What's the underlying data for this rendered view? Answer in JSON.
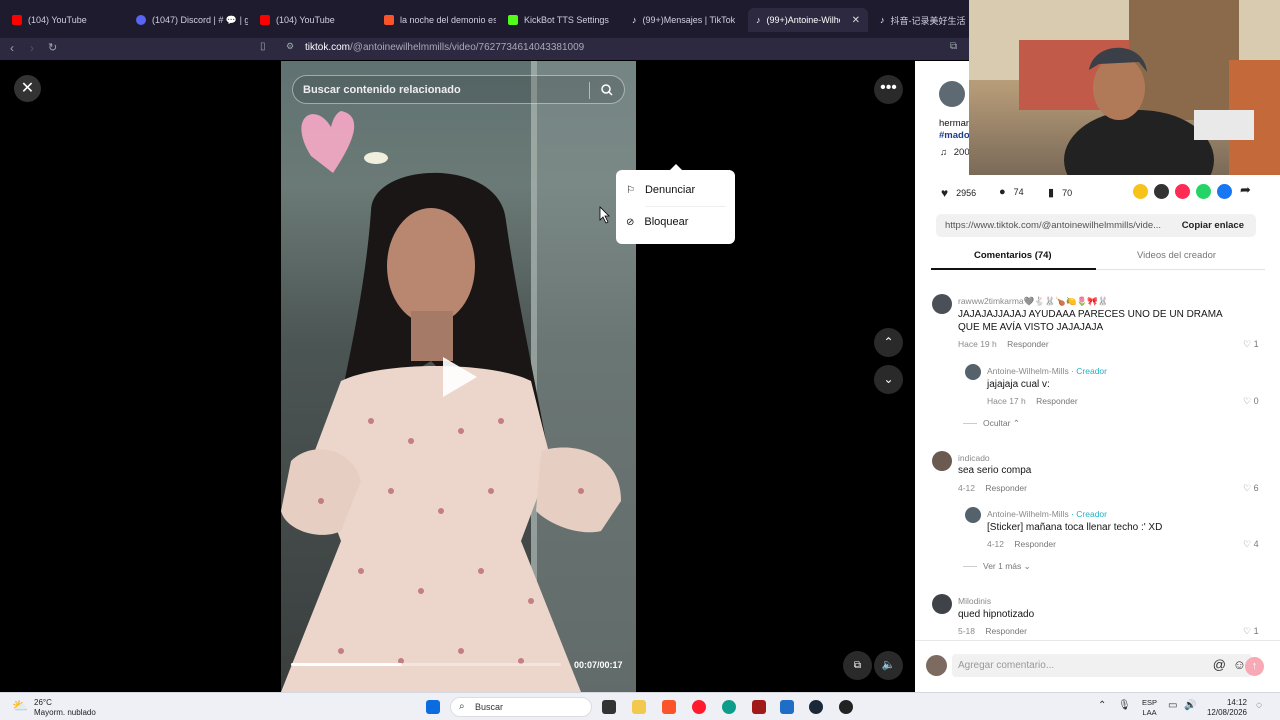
{
  "browser": {
    "tabs": [
      {
        "label": "(104) YouTube",
        "color": "#ff0000"
      },
      {
        "label": "(1047) Discord | # 💬 | gaming",
        "color": "#5865f2"
      },
      {
        "label": "(104) YouTube",
        "color": "#ff0000"
      },
      {
        "label": "la noche del demonio est",
        "color": "#fb542b"
      },
      {
        "label": "KickBot TTS Settings",
        "color": "#53fc18"
      },
      {
        "label": "(99+)Mensajes | TikTok",
        "color": "#ffffff"
      },
      {
        "label": "(99+)Antoine-Wilhelm",
        "color": "#ffffff"
      },
      {
        "label": "抖音-记录美好生活",
        "color": "#ffffff"
      }
    ],
    "url_domain": "tiktok.com",
    "url_path": "/@antoinewilhelmmills/video/7627734614043381009"
  },
  "video": {
    "search_placeholder": "Buscar contenido relacionado",
    "timecode": "00:07/00:17",
    "progress_fraction": 0.41,
    "menu": {
      "report": "Denunciar",
      "block": "Bloquear"
    }
  },
  "panel": {
    "caption_user": "herman",
    "caption_tag": "#mado",
    "music": "200",
    "stats": {
      "likes": "2956",
      "comments": "74",
      "saves": "70"
    },
    "link": "https://www.tiktok.com/@antoinewilhelmmills/vide...",
    "copy_link": "Copiar enlace",
    "tab_comments": "Comentarios (74)",
    "tab_videos": "Videos del creador",
    "reply_label": "Responder",
    "creator_label": "· Creador",
    "comments": [
      {
        "user": "rawww2timkarma🩶🐇🐰🍗🍋🌷🎀🐰",
        "text": "JAJAJAJJAJAJ AYUDAAA PARECES UNO DE UN DRAMA QUE ME AVÍA VISTO JAJAJAJA",
        "time": "Hace 19 h",
        "likes": "1"
      },
      {
        "user": "Antoine-Wilhelm-Mills",
        "text": "jajajaja cual v:",
        "time": "Hace 17 h",
        "likes": "0"
      },
      {
        "user": "indicado",
        "text": "sea serio compa",
        "time": "4-12",
        "likes": "6"
      },
      {
        "user": "Antoine-Wilhelm-Mills",
        "text": "[Sticker] mañana toca llenar techo :' XD",
        "time": "4-12",
        "likes": "4"
      },
      {
        "user": "Milodinis",
        "text": "qued hipnotizado",
        "time": "5-18",
        "likes": "1"
      }
    ],
    "hide_label": "Ocultar",
    "more_label": "Ver 1 más",
    "comment_placeholder": "Agregar comentario..."
  },
  "taskbar": {
    "weather_temp": "26°C",
    "weather_desc": "Mayorm. nublado",
    "search": "Buscar",
    "lang": "ESP",
    "lang2": "LAA",
    "time": "14:12",
    "date": "12/08/2026"
  }
}
